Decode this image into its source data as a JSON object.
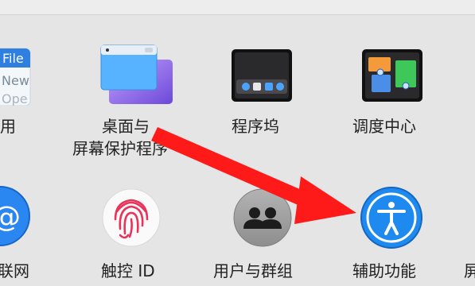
{
  "window": {
    "title": ""
  },
  "panes": {
    "general_partial": {
      "label": "用",
      "icon": "general-icon",
      "file_text": "File",
      "new_text": "New",
      "open_text": "Ope"
    },
    "desktop": {
      "label_line1": "桌面与",
      "label_line2": "屏幕保护程序",
      "icon": "desktop-screensaver-icon"
    },
    "dock": {
      "label": "程序坞",
      "icon": "dock-icon"
    },
    "mission_control": {
      "label": "调度中心",
      "icon": "mission-control-icon"
    },
    "internet_partial": {
      "label": "联网",
      "icon": "internet-accounts-icon"
    },
    "touch_id": {
      "label": "触控 ID",
      "icon": "fingerprint-icon"
    },
    "users_groups": {
      "label": "用户与群组",
      "icon": "users-groups-icon"
    },
    "accessibility": {
      "label": "辅助功能",
      "icon": "accessibility-icon"
    },
    "screen_time_partial": {
      "label": "屏",
      "icon": ""
    }
  },
  "annotation": {
    "arrow_color": "#ff1a1a",
    "points_to": "accessibility"
  }
}
